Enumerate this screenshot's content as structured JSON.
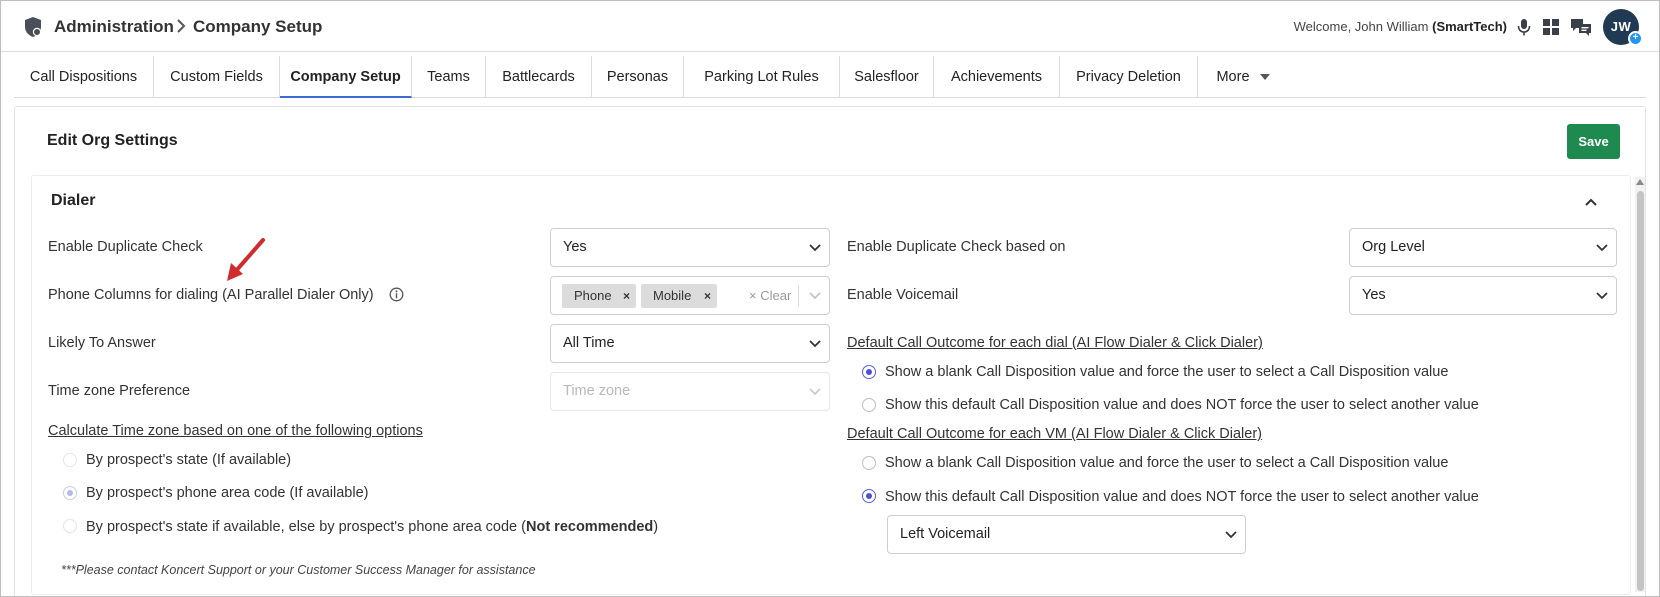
{
  "header": {
    "breadcrumb_root": "Administration",
    "breadcrumb_current": "Company Setup",
    "welcome_prefix": "Welcome, John William ",
    "welcome_org": "(SmartTech)",
    "avatar_initials": "JW",
    "avatar_badge": "+",
    "icons": [
      "shield-icon",
      "chevron-right-icon",
      "microphone-icon",
      "apps-grid-icon",
      "chat-icon"
    ]
  },
  "tabs": [
    {
      "label": "Call Dispositions"
    },
    {
      "label": "Custom Fields"
    },
    {
      "label": "Company Setup",
      "active": true
    },
    {
      "label": "Teams"
    },
    {
      "label": "Battlecards"
    },
    {
      "label": "Personas"
    },
    {
      "label": "Parking Lot Rules"
    },
    {
      "label": "Salesfloor"
    },
    {
      "label": "Achievements"
    },
    {
      "label": "Privacy Deletion"
    },
    {
      "label": "More"
    }
  ],
  "panel": {
    "title": "Edit Org Settings",
    "save_label": "Save"
  },
  "dialer": {
    "title": "Dialer",
    "left": {
      "dup_check_label": "Enable Duplicate Check",
      "dup_check_value": "Yes",
      "phone_cols_label": "Phone Columns for dialing (AI Parallel Dialer Only)",
      "chips": [
        "Phone",
        "Mobile"
      ],
      "chip_remove": "×",
      "clear_label": "× Clear",
      "likely_label": "Likely To Answer",
      "likely_value": "All Time",
      "tz_label": "Time zone Preference",
      "tz_placeholder": "Time zone",
      "calc_label": "Calculate Time zone based on one of the following options",
      "tz_options": [
        "By prospect's state (If available)",
        "By prospect's phone area code (If available)",
        "By prospect's state if available, else by prospect's phone area code ("
      ],
      "tz_option3_bold": "Not recommended",
      "tz_option3_end": ")",
      "tz_selected_index": 1,
      "note": "***Please contact Koncert Support or your Customer Success Manager for assistance"
    },
    "right": {
      "dup_based_label": "Enable Duplicate Check based on",
      "dup_based_value": "Org Level",
      "voicemail_label": "Enable Voicemail",
      "voicemail_value": "Yes",
      "dial_outcome_label": "Default Call Outcome for each dial (AI Flow Dialer & Click Dialer)",
      "dial_options": [
        "Show a blank Call Disposition value and force the user to select a Call Disposition value",
        "Show this default Call Disposition value and does NOT force the user to select another value"
      ],
      "dial_selected_index": 0,
      "vm_outcome_label": "Default Call Outcome for each VM (AI Flow Dialer & Click Dialer)",
      "vm_options": [
        "Show a blank Call Disposition value and force the user to select a Call Disposition value",
        "Show this default Call Disposition value and does NOT force the user to select another value"
      ],
      "vm_selected_index": 1,
      "vm_disposition_value": "Left Voicemail"
    }
  },
  "colors": {
    "accent": "#3e6bd1",
    "save": "#1f8a4f",
    "radio": "#4b50d9",
    "annotation_arrow": "#d12b2b"
  }
}
